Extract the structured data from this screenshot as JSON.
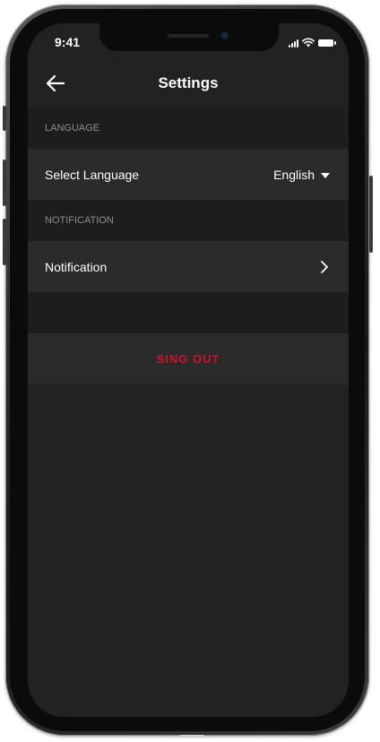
{
  "status_bar": {
    "time": "9:41",
    "icons": [
      "signal-icon",
      "wifi-icon",
      "battery-icon"
    ]
  },
  "header": {
    "back_icon": "arrow-left-icon",
    "title": "Settings"
  },
  "sections": {
    "language": {
      "header": "LANGUAGE",
      "row_label": "Select Language",
      "selected_value": "English",
      "dropdown_icon": "caret-down-icon"
    },
    "notification": {
      "header": "NOTIFICATION",
      "row_label": "Notification",
      "chevron_icon": "chevron-right-icon"
    }
  },
  "sign_out": {
    "label": "SING OUT"
  },
  "colors": {
    "background": "#212121",
    "section_background": "#1d1d1d",
    "row_background": "#2a2a2a",
    "text_primary": "#ffffff",
    "text_secondary": "#8d8d8d",
    "accent_red": "#d0132b"
  }
}
